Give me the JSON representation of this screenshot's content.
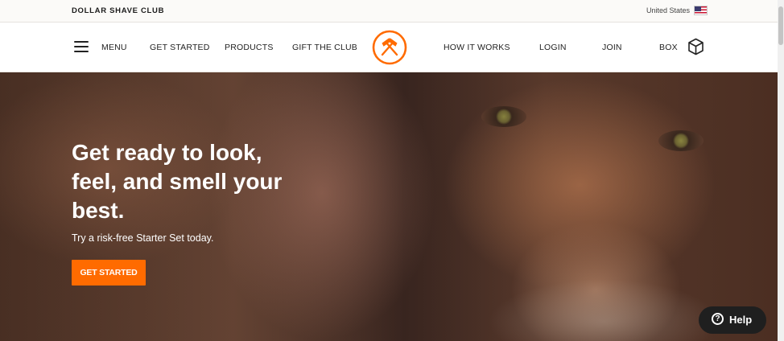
{
  "topbar": {
    "brand": "DOLLAR SHAVE CLUB",
    "country": "United States",
    "flag_icon": "us-flag-icon"
  },
  "nav": {
    "menu_label": "MENU",
    "left_items": [
      "GET STARTED",
      "PRODUCTS",
      "GIFT THE CLUB"
    ],
    "right_items": [
      "HOW IT WORKS",
      "LOGIN",
      "JOIN",
      "BOX"
    ],
    "logo_icon": "crossed-razors-logo-icon",
    "box_icon": "box-cube-icon",
    "menu_icon": "hamburger-menu-icon"
  },
  "hero": {
    "headline": "Get ready to look, feel, and smell your best.",
    "subline": "Try a risk-free Starter Set today.",
    "cta_label": "GET STARTED"
  },
  "help": {
    "label": "Help",
    "icon": "question-circle-icon"
  },
  "colors": {
    "accent": "#ff6b00",
    "help_bg": "#1f1f1f",
    "topbar_bg": "#fbfaf8"
  }
}
